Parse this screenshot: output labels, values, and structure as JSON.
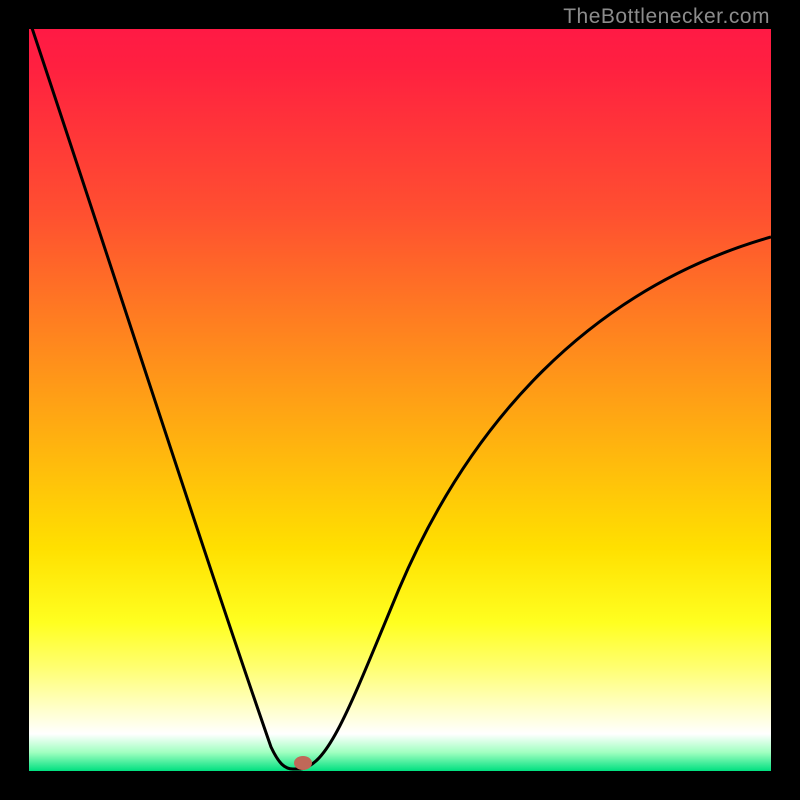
{
  "attribution": "TheBottlenecker.com",
  "chart_data": {
    "type": "line",
    "title": "",
    "xlabel": "",
    "ylabel": "",
    "xlim": [
      0,
      100
    ],
    "ylim": [
      0,
      100
    ],
    "background_gradient": "red-yellow-green",
    "curve": {
      "description": "V-shaped bottleneck curve with minimum marker",
      "minimum_x": 36,
      "minimum_y": 0,
      "left_endpoint": {
        "x": 0,
        "y": 100
      },
      "right_endpoint": {
        "x": 100,
        "y": 72
      },
      "marker": {
        "x": 36,
        "y": 0.8,
        "color": "#b25a5a"
      }
    }
  }
}
